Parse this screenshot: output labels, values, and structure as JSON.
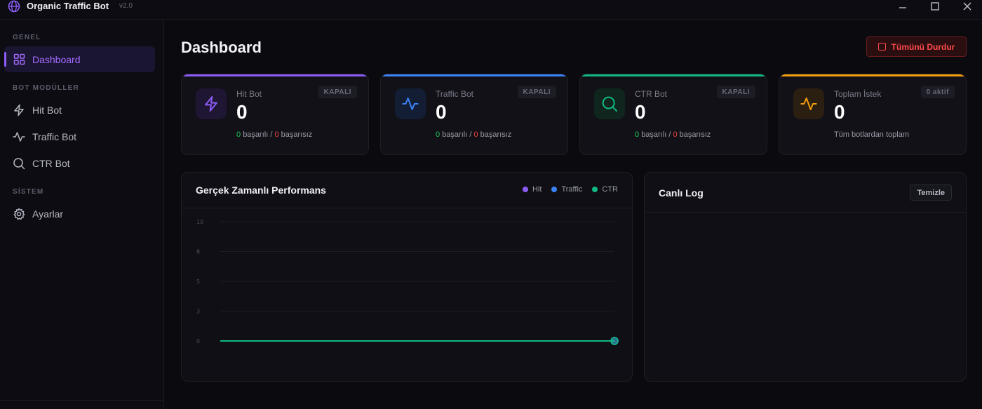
{
  "window": {
    "title": "Organic Traffic Bot",
    "version": "v2.0"
  },
  "sidebar": {
    "sections": [
      {
        "label": "GENEL"
      },
      {
        "label": "BOT MODÜLLER"
      },
      {
        "label": "SİSTEM"
      }
    ],
    "items": [
      {
        "label": "Dashboard",
        "icon": "grid-icon",
        "active": true
      },
      {
        "label": "Hit Bot",
        "icon": "lightning-icon"
      },
      {
        "label": "Traffic Bot",
        "icon": "activity-icon"
      },
      {
        "label": "CTR Bot",
        "icon": "search-icon"
      },
      {
        "label": "Ayarlar",
        "icon": "gear-icon"
      }
    ]
  },
  "header": {
    "title": "Dashboard",
    "stop_all_label": "Tümünü Durdur"
  },
  "colors": {
    "accent": "#8b5cf6",
    "hit": "#8b5cf6",
    "traffic": "#3b82f6",
    "ctr": "#10b981",
    "total": "#f59e0b",
    "danger": "#ef4444",
    "success": "#22c55e"
  },
  "stats": [
    {
      "label": "Hit Bot",
      "value": "0",
      "badge": "KAPALI",
      "success": "0",
      "success_label": "başarılı",
      "sep": " / ",
      "fail": "0",
      "fail_label": "başarısız",
      "icon": "lightning-icon"
    },
    {
      "label": "Traffic Bot",
      "value": "0",
      "badge": "KAPALI",
      "success": "0",
      "success_label": "başarılı",
      "sep": " / ",
      "fail": "0",
      "fail_label": "başarısız",
      "icon": "activity-icon"
    },
    {
      "label": "CTR Bot",
      "value": "0",
      "badge": "KAPALI",
      "success": "0",
      "success_label": "başarılı",
      "sep": " / ",
      "fail": "0",
      "fail_label": "başarısız",
      "icon": "search-icon"
    },
    {
      "label": "Toplam İstek",
      "value": "0",
      "badge": "0 aktif",
      "subtitle": "Tüm botlardan toplam",
      "icon": "pulse-icon"
    }
  ],
  "performance": {
    "title": "Gerçek Zamanlı Performans",
    "legend": [
      {
        "name": "Hit",
        "color": "#8b5cf6"
      },
      {
        "name": "Traffic",
        "color": "#3b82f6"
      },
      {
        "name": "CTR",
        "color": "#10b981"
      }
    ]
  },
  "chart_data": {
    "type": "line",
    "title": "Gerçek Zamanlı Performans",
    "ylim": [
      0,
      10
    ],
    "yticks": [
      "0",
      "3",
      "5",
      "8",
      "10"
    ],
    "ytick_values": [
      0,
      2.5,
      5,
      7.5,
      10
    ],
    "grid": true,
    "legend_placement": "top-right",
    "series": [
      {
        "name": "Hit",
        "color": "#8b5cf6",
        "values": [
          0,
          0
        ]
      },
      {
        "name": "Traffic",
        "color": "#3b82f6",
        "values": [
          0,
          0
        ]
      },
      {
        "name": "CTR",
        "color": "#10b981",
        "values": [
          0,
          0
        ]
      }
    ]
  },
  "log": {
    "title": "Canlı Log",
    "clear_label": "Temizle"
  }
}
